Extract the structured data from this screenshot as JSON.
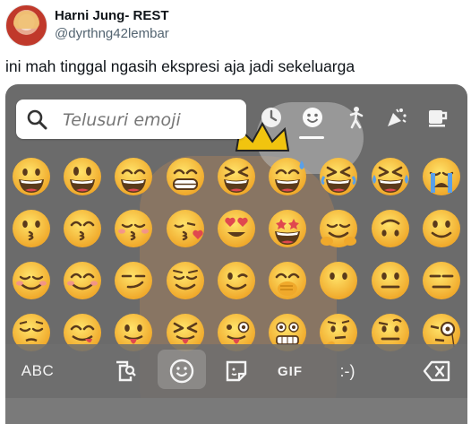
{
  "tweet": {
    "author_name": "Harni Jung- REST",
    "author_handle": "@dyrthng42lembar",
    "text": "ini mah tinggal ngasih ekspresi aja jadi sekeluarga"
  },
  "keyboard": {
    "search_placeholder": "Telusuri emoji",
    "categories": [
      "recent-icon",
      "smileys-icon",
      "people-activity-icon",
      "celebration-icon",
      "food-drink-icon"
    ],
    "active_category": "smileys-icon",
    "bottom_bar": {
      "abc_label": "ABC",
      "gif_label": "GIF",
      "emoticon_label": ":-)"
    },
    "emoji_rows": [
      [
        "grinning-face",
        "grinning-big-eyes",
        "grinning-smiling-eyes",
        "beaming-face",
        "squinting-laugh",
        "grinning-sweat",
        "rolling-laughing",
        "tears-of-joy",
        "loudly-crying"
      ],
      [
        "kissing-face",
        "kissing-smiling-eyes",
        "kissing-closed-eyes",
        "face-blowing-kiss",
        "heart-eyes",
        "star-struck",
        "smiling-hearts-hug",
        "upside-down-face",
        "slightly-smiling"
      ],
      [
        "smiling-blush",
        "smiling-eyes",
        "smirking-face",
        "relieved-face",
        "winking-face",
        "hand-over-mouth",
        "no-mouth",
        "neutral-face",
        "expressionless"
      ],
      [
        "pensive-face",
        "savoring-food",
        "tongue-out",
        "squinting-tongue",
        "zany-face",
        "grimacing-face",
        "thinking-face",
        "raised-eyebrow",
        "monocle-face"
      ]
    ]
  }
}
